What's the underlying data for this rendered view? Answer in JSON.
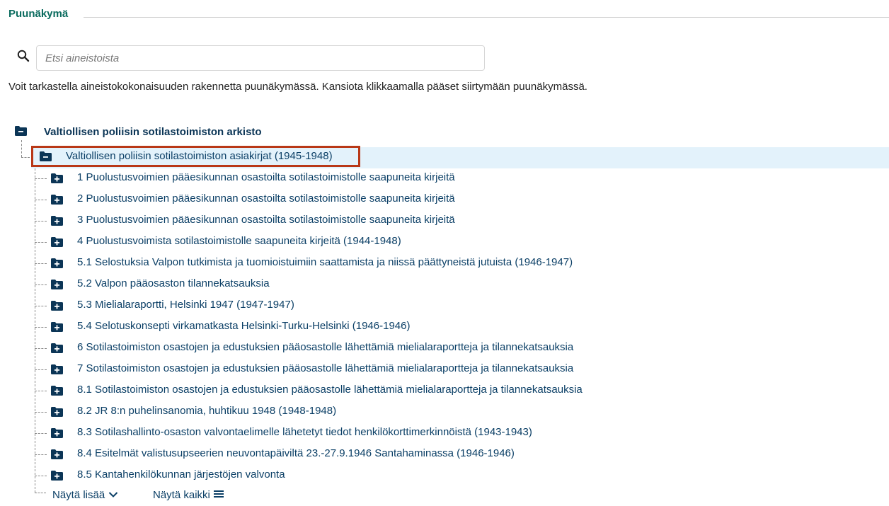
{
  "section": {
    "title": "Puunäkymä"
  },
  "search": {
    "placeholder": "Etsi aineistoista",
    "value": ""
  },
  "intro_text": "Voit tarkastella aineistokokonaisuuden rakennetta puunäkymässä. Kansiota klikkaamalla pääset siirtymään puunäkymässä.",
  "tree": {
    "root": {
      "label": "Valtiollisen poliisin sotilastoimiston arkisto",
      "icon": "folder-minus-icon"
    },
    "selected": {
      "label": "Valtiollisen poliisin sotilastoimiston asiakirjat (1945-1948)",
      "icon": "folder-minus-icon"
    },
    "children": [
      {
        "label": "1 Puolustusvoimien pääesikunnan osastoilta sotilastoimistolle saapuneita kirjeitä",
        "icon": "folder-plus-icon"
      },
      {
        "label": "2 Puolustusvoimien pääesikunnan osastoilta sotilastoimistolle saapuneita kirjeitä",
        "icon": "folder-plus-icon"
      },
      {
        "label": "3 Puolustusvoimien pääesikunnan osastoilta sotilastoimistolle saapuneita kirjeitä",
        "icon": "folder-plus-icon"
      },
      {
        "label": "4 Puolustusvoimista sotilastoimistolle saapuneita kirjeitä (1944-1948)",
        "icon": "folder-plus-icon"
      },
      {
        "label": "5.1 Selostuksia Valpon tutkimista ja tuomioistuimiin saattamista ja niissä päättyneistä jutuista (1946-1947)",
        "icon": "folder-plus-icon"
      },
      {
        "label": "5.2 Valpon pääosaston tilannekatsauksia",
        "icon": "folder-plus-icon"
      },
      {
        "label": "5.3 Mielialaraportti, Helsinki 1947 (1947-1947)",
        "icon": "folder-plus-icon"
      },
      {
        "label": "5.4 Selotuskonsepti virkamatkasta Helsinki-Turku-Helsinki (1946-1946)",
        "icon": "folder-plus-icon"
      },
      {
        "label": "6 Sotilastoimiston osastojen ja edustuksien pääosastolle lähettämiä mielialaraportteja ja tilannekatsauksia",
        "icon": "folder-plus-icon"
      },
      {
        "label": "7 Sotilastoimiston osastojen ja edustuksien pääosastolle lähettämiä mielialaraportteja ja tilannekatsauksia",
        "icon": "folder-plus-icon"
      },
      {
        "label": "8.1 Sotilastoimiston osastojen ja edustuksien pääosastolle lähettämiä mielialaraportteja ja tilannekatsauksia",
        "icon": "folder-plus-icon"
      },
      {
        "label": "8.2 JR 8:n puhelinsanomia, huhtikuu 1948 (1948-1948)",
        "icon": "folder-plus-icon"
      },
      {
        "label": "8.3 Sotilashallinto-osaston valvontaelimelle lähetetyt tiedot henkilökorttimerkinnöistä (1943-1943)",
        "icon": "folder-plus-icon"
      },
      {
        "label": "8.4 Esitelmät valistusupseerien neuvontapäiviltä 23.-27.9.1946 Santahaminassa (1946-1946)",
        "icon": "folder-plus-icon"
      },
      {
        "label": "8.5 Kantahenkilökunnan järjestöjen valvonta",
        "icon": "folder-plus-icon"
      }
    ],
    "show_more_label": "Näytä lisää",
    "show_all_label": "Näytä kaikki"
  },
  "colors": {
    "accent": "#0a6b5e",
    "link": "#0b3f66",
    "folder": "#0b3556",
    "selected_bg": "#e3f2fb",
    "highlight": "#b93817"
  }
}
